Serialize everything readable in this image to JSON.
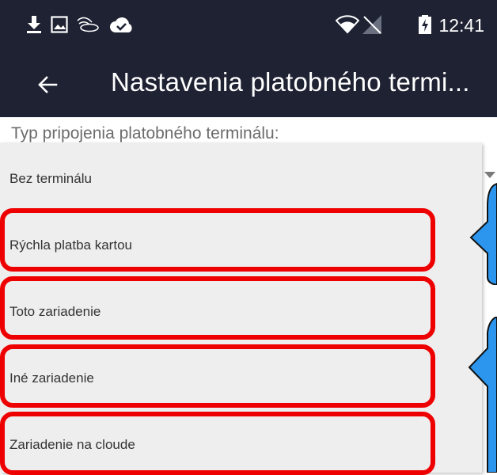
{
  "status_bar": {
    "time": "12:41",
    "icons": [
      "download-icon",
      "image-icon",
      "cast-icon",
      "cloud-check-icon",
      "wifi-icon",
      "no-signal-icon",
      "battery-charging-icon"
    ]
  },
  "app_bar": {
    "back_icon": "arrow-left-icon",
    "title": "Nastavenia platobného termi..."
  },
  "field": {
    "label": "Typ pripojenia platobného terminálu:",
    "selected": "Bez terminálu"
  },
  "options": [
    {
      "label": "Bez terminálu"
    },
    {
      "label": "Rýchla platba kartou"
    },
    {
      "label": "Toto zariadenie"
    },
    {
      "label": "Iné zariadenie"
    },
    {
      "label": "Zariadenie na cloude"
    }
  ],
  "colors": {
    "bar": "#1e2233",
    "highlight": "#ee0000",
    "callout": "#2c96ee",
    "menu_bg": "#eeeeee"
  }
}
